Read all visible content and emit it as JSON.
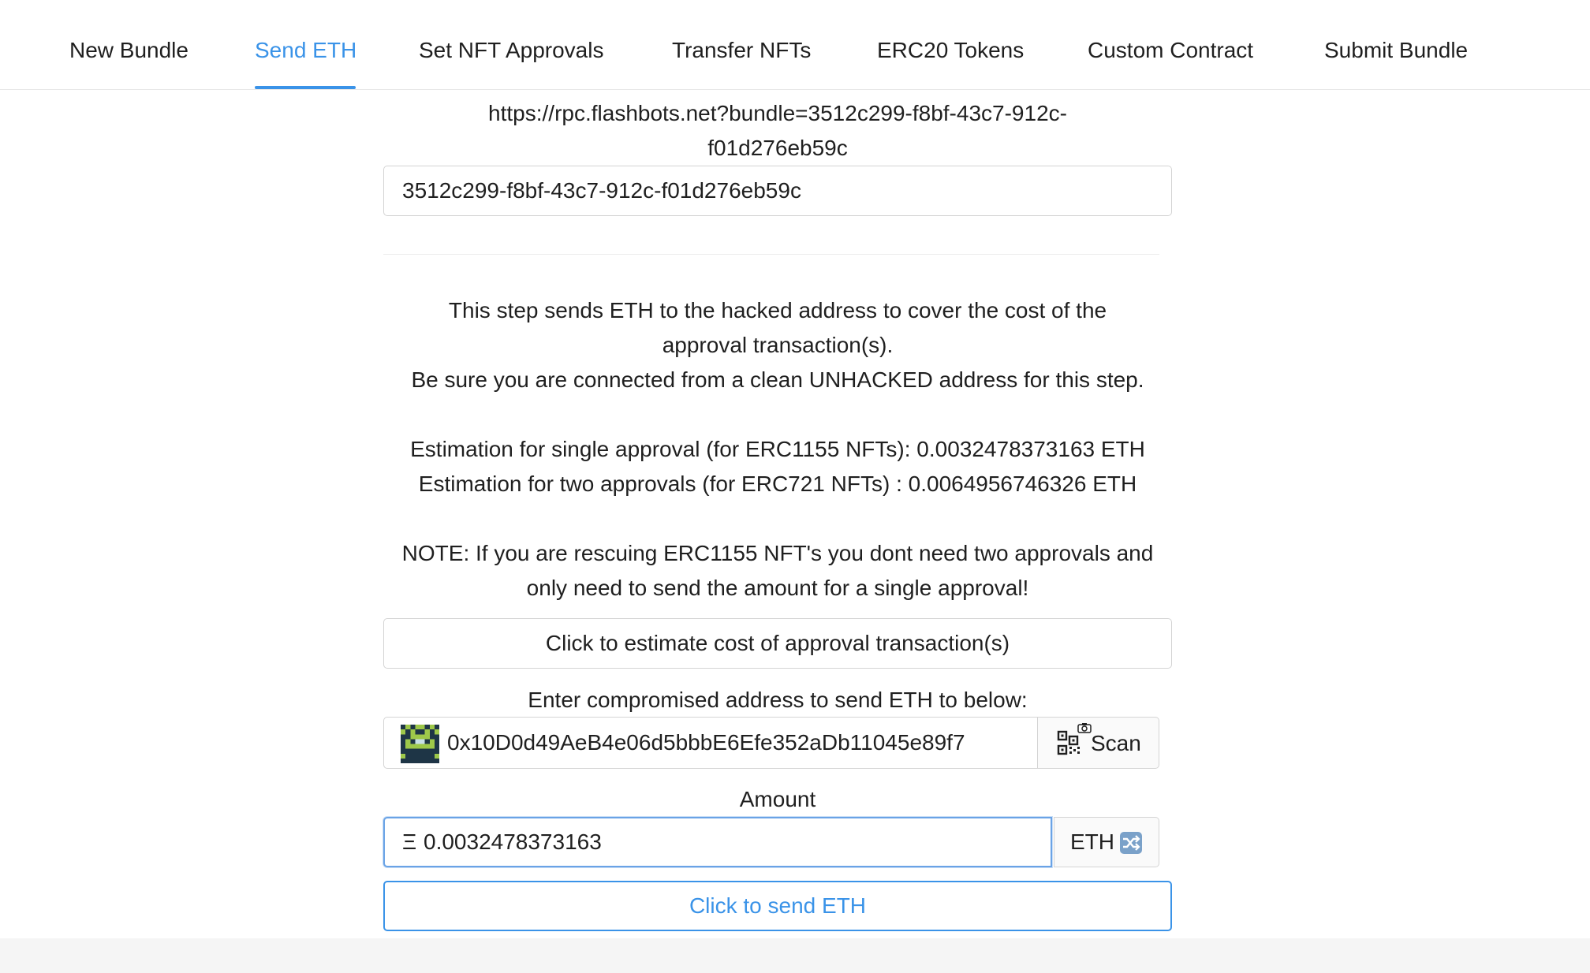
{
  "tabs": [
    "New Bundle",
    "Send ETH",
    "Set NFT Approvals",
    "Transfer NFTs",
    "ERC20 Tokens",
    "Custom Contract",
    "Submit Bundle"
  ],
  "active_tab": "Send ETH",
  "bundle": {
    "rpc_url_line1": "https://rpc.flashbots.net?bundle=3512c299-f8bf-43c7-912c-",
    "rpc_url_line2": "f01d276eb59c",
    "bundle_id_value": "3512c299-f8bf-43c7-912c-f01d276eb59c"
  },
  "info": {
    "line1": "This step sends ETH to the hacked address to cover the cost of the",
    "line2": "approval transaction(s).",
    "line3": "Be sure you are connected from a clean UNHACKED address for this step.",
    "estimate_single": "Estimation for single approval (for ERC1155 NFTs): 0.0032478373163 ETH",
    "estimate_double": "Estimation for two approvals (for ERC721 NFTs) : 0.0064956746326 ETH",
    "note_line1": "NOTE: If you are rescuing ERC1155 NFT's you dont need two approvals and",
    "note_line2": "only need to send the amount for a single approval!"
  },
  "estimate_button_label": "Click to estimate cost of approval transaction(s)",
  "address": {
    "label": "Enter compromised address to send ETH to below:",
    "value": "0x10D0d49AeB4e06d5bbbE6Efe352aDb11045e89f7",
    "scan_label": "Scan"
  },
  "amount": {
    "label": "Amount",
    "prefix": "Ξ",
    "value": "0.0032478373163",
    "unit_label": "ETH"
  },
  "send_button_label": "Click to send ETH",
  "colors": {
    "accent": "#3a93e8",
    "border": "#d4d4d4",
    "text": "#1f1f1f"
  },
  "icons": {
    "blockie": "blockie-avatar-icon",
    "qr": "qr-code-icon",
    "camera": "camera-icon",
    "swap": "swap-icon"
  }
}
